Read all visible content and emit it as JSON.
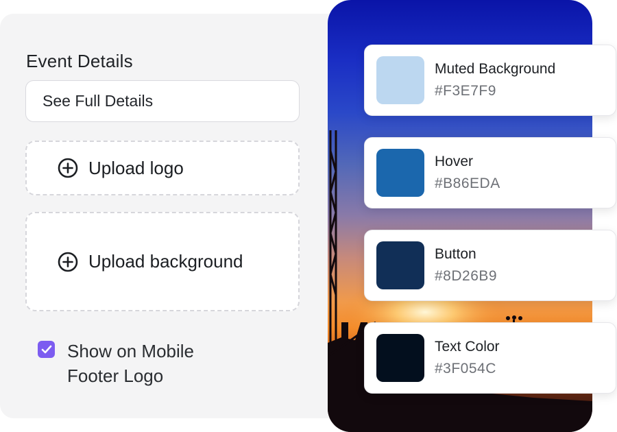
{
  "event_details": {
    "title": "Event Details",
    "details_button_label": "See Full Details",
    "upload_logo_label": "Upload logo",
    "upload_background_label": "Upload background",
    "show_mobile_footer_logo": {
      "checked": true,
      "label": "Show on Mobile Footer Logo"
    }
  },
  "colors": [
    {
      "name": "Muted Background",
      "hex": "#F3E7F9",
      "swatch": "#bcd7f0"
    },
    {
      "name": "Hover",
      "hex": "#B86EDA",
      "swatch": "#1b67ad"
    },
    {
      "name": "Button",
      "hex": "#8D26B9",
      "swatch": "#112f57"
    },
    {
      "name": "Text Color",
      "hex": "#3F054C",
      "swatch": "#030f1e"
    }
  ],
  "accent_color": "#7c5cf0",
  "icons": {
    "upload": "plus-circle-icon",
    "checkbox": "checkmark-icon"
  }
}
